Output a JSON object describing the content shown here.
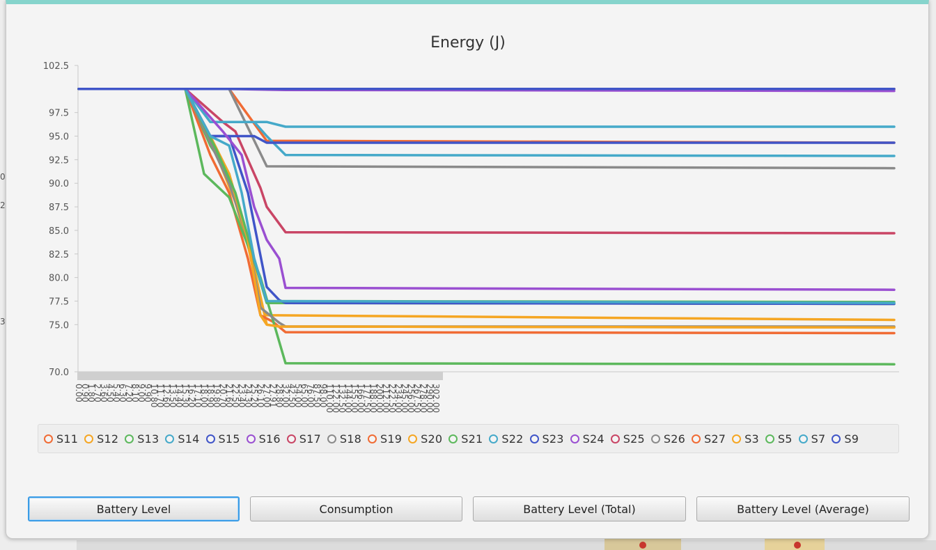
{
  "chart_data": {
    "type": "line",
    "title": "Energy (J)",
    "xlabel": "",
    "ylabel": "",
    "ylim": [
      70.0,
      102.5
    ],
    "yticks": [
      "70.0",
      "75.0",
      "77.5",
      "80.0",
      "82.5",
      "85.0",
      "87.5",
      "90.0",
      "92.5",
      "95.0",
      "97.5",
      "102.5"
    ],
    "categories": [
      "0.00",
      "0.90",
      "1.80",
      "2.70",
      "3.60",
      "4.50",
      "5.40",
      "6.30",
      "7.20",
      "8.10",
      "9.00",
      "9.90",
      "10.80",
      "11.70",
      "12.60",
      "13.50",
      "14.40",
      "15.30",
      "16.20",
      "17.10",
      "18.00",
      "18.90",
      "19.80",
      "20.70",
      "21.60",
      "22.50",
      "23.40",
      "24.30",
      "25.20",
      "26.10",
      "27.00",
      "27.91",
      "28.80",
      "32.00",
      "42.50",
      "54.00",
      "65.00",
      "76.00",
      "87.50",
      "98.00",
      "110.00",
      "122.00",
      "132.50",
      "144.00",
      "155.00",
      "166.00",
      "177.50",
      "188.00",
      "200.00",
      "212.00",
      "222.50",
      "234.00",
      "245.00",
      "256.00",
      "267.50",
      "278.00",
      "290.00",
      "302.00"
    ],
    "legend_position": "bottom",
    "series": [
      {
        "name": "S11",
        "color": "#f06b34",
        "x": [
          "0.00",
          "15.30",
          "21.60",
          "27.00",
          "302.00"
        ],
        "values": [
          100.0,
          100.0,
          100.0,
          94.5,
          94.3
        ]
      },
      {
        "name": "S12",
        "color": "#f5a623",
        "x": [
          "0.00",
          "15.30",
          "19.80",
          "22.50",
          "25.20",
          "27.00",
          "28.80",
          "302.00"
        ],
        "values": [
          100.0,
          100.0,
          93.0,
          88.0,
          81.0,
          75.0,
          74.8,
          74.7
        ]
      },
      {
        "name": "S13",
        "color": "#5cb85c",
        "x": [
          "0.00",
          "15.30",
          "18.90",
          "21.60",
          "24.30",
          "27.00",
          "302.00"
        ],
        "values": [
          100.0,
          100.0,
          94.0,
          91.0,
          84.0,
          77.3,
          77.2
        ]
      },
      {
        "name": "S14",
        "color": "#45a9c9",
        "x": [
          "0.00",
          "15.30",
          "18.90",
          "27.00",
          "32.00",
          "302.00"
        ],
        "values": [
          100.0,
          100.0,
          96.5,
          96.5,
          96.0,
          96.0
        ]
      },
      {
        "name": "S15",
        "color": "#4055c8",
        "x": [
          "0.00",
          "15.30",
          "18.90",
          "21.60",
          "24.30",
          "27.00",
          "28.80",
          "32.00",
          "302.00"
        ],
        "values": [
          100.0,
          100.0,
          95.0,
          95.0,
          89.0,
          79.0,
          77.6,
          77.3,
          77.2
        ]
      },
      {
        "name": "S16",
        "color": "#9a4fd1",
        "x": [
          "0.00",
          "15.30",
          "21.60",
          "32.00",
          "302.00"
        ],
        "values": [
          100.0,
          100.0,
          100.0,
          99.9,
          99.8
        ]
      },
      {
        "name": "S17",
        "color": "#c94565",
        "x": [
          "0.00",
          "15.30",
          "20.70",
          "22.50",
          "26.10",
          "27.00",
          "32.00",
          "302.00"
        ],
        "values": [
          100.0,
          100.0,
          96.5,
          95.5,
          89.5,
          87.5,
          84.8,
          84.7
        ]
      },
      {
        "name": "S18",
        "color": "#8a8a8a",
        "x": [
          "0.00",
          "15.30",
          "21.60",
          "27.00",
          "302.00"
        ],
        "values": [
          100.0,
          100.0,
          100.0,
          91.8,
          91.6
        ]
      },
      {
        "name": "S19",
        "color": "#f06b34",
        "x": [
          "0.00",
          "15.30",
          "18.90",
          "21.60",
          "24.30",
          "26.10",
          "27.91",
          "32.00",
          "302.00"
        ],
        "values": [
          100.0,
          100.0,
          93.0,
          89.0,
          82.0,
          76.0,
          75.3,
          74.2,
          74.1
        ]
      },
      {
        "name": "S20",
        "color": "#f5a623",
        "x": [
          "0.00",
          "15.30",
          "18.90",
          "21.60",
          "24.30",
          "26.10",
          "27.00",
          "302.00"
        ],
        "values": [
          100.0,
          100.0,
          95.0,
          91.0,
          83.5,
          77.0,
          76.0,
          75.5
        ]
      },
      {
        "name": "S21",
        "color": "#5cb85c",
        "x": [
          "0.00",
          "15.30",
          "18.00",
          "21.60",
          "26.10",
          "32.00",
          "302.00"
        ],
        "values": [
          100.0,
          100.0,
          91.0,
          88.5,
          80.0,
          70.9,
          70.8
        ]
      },
      {
        "name": "S22",
        "color": "#45a9c9",
        "x": [
          "0.00",
          "15.30",
          "18.90",
          "21.60",
          "25.20",
          "27.00",
          "32.00",
          "302.00"
        ],
        "values": [
          100.0,
          100.0,
          96.5,
          96.5,
          96.5,
          95.0,
          93.0,
          92.9
        ]
      },
      {
        "name": "S23",
        "color": "#4055c8",
        "x": [
          "0.00",
          "15.30",
          "18.90",
          "21.60",
          "25.20",
          "27.00",
          "32.00",
          "302.00"
        ],
        "values": [
          100.0,
          100.0,
          95.0,
          95.0,
          95.0,
          94.3,
          94.3,
          94.3
        ]
      },
      {
        "name": "S24",
        "color": "#9a4fd1",
        "x": [
          "0.00",
          "15.30",
          "20.70",
          "23.40",
          "25.20",
          "27.00",
          "28.80",
          "32.00",
          "302.00"
        ],
        "values": [
          100.0,
          100.0,
          95.5,
          93.0,
          87.5,
          84.0,
          82.0,
          78.9,
          78.7
        ]
      },
      {
        "name": "S25",
        "color": "#c94565",
        "x": [
          "0.00",
          "302.00"
        ],
        "values": [
          100.0,
          100.0
        ]
      },
      {
        "name": "S26",
        "color": "#8a8a8a",
        "x": [
          "0.00",
          "15.30",
          "21.60",
          "24.30",
          "26.10",
          "28.80",
          "32.00",
          "302.00"
        ],
        "values": [
          100.0,
          100.0,
          90.0,
          84.0,
          76.8,
          75.2,
          74.8,
          74.8
        ]
      },
      {
        "name": "S27",
        "color": "#f06b34",
        "x": [
          "0.00",
          "302.00"
        ],
        "values": [
          100.0,
          100.0
        ]
      },
      {
        "name": "S3",
        "color": "#f5a623",
        "x": [
          "0.00",
          "15.30",
          "21.60",
          "24.30",
          "26.10",
          "27.00",
          "28.80",
          "302.00"
        ],
        "values": [
          100.0,
          100.0,
          91.0,
          84.0,
          76.0,
          75.0,
          74.8,
          74.7
        ]
      },
      {
        "name": "S5",
        "color": "#5cb85c",
        "x": [
          "0.00",
          "15.30",
          "19.80",
          "22.50",
          "25.20",
          "27.00",
          "302.00"
        ],
        "values": [
          100.0,
          100.0,
          93.5,
          89.0,
          82.0,
          77.5,
          77.4
        ]
      },
      {
        "name": "S7",
        "color": "#45a9c9",
        "x": [
          "0.00",
          "15.30",
          "18.90",
          "21.60",
          "23.40",
          "25.20",
          "27.00",
          "302.00"
        ],
        "values": [
          100.0,
          100.0,
          95.0,
          94.0,
          89.0,
          82.0,
          77.5,
          77.3
        ]
      },
      {
        "name": "S9",
        "color": "#4055c8",
        "x": [
          "0.00",
          "15.30",
          "302.00"
        ],
        "values": [
          100.0,
          100.0,
          100.0
        ]
      }
    ]
  },
  "buttons": {
    "battery_level": "Battery Level",
    "consumption": "Consumption",
    "battery_level_total": "Battery Level (Total)",
    "battery_level_average": "Battery Level (Average)"
  },
  "background": {
    "edge_numbers": [
      "0",
      "2",
      "3"
    ]
  }
}
